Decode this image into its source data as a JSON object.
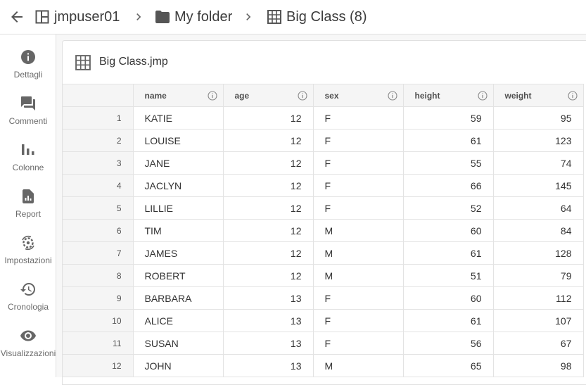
{
  "breadcrumb": {
    "user": "jmpuser01",
    "folder": "My folder",
    "table": "Big Class (8)"
  },
  "sidebar": {
    "items": [
      {
        "label": "Dettagli",
        "icon": "info-icon"
      },
      {
        "label": "Commenti",
        "icon": "comments-icon"
      },
      {
        "label": "Colonne",
        "icon": "columns-chart-icon"
      },
      {
        "label": "Report",
        "icon": "report-icon"
      },
      {
        "label": "Impostazioni",
        "icon": "settings-icon"
      },
      {
        "label": "Cronologia",
        "icon": "history-icon"
      },
      {
        "label": "Visualizzazioni",
        "icon": "eye-icon"
      }
    ]
  },
  "panel": {
    "title": "Big Class.jmp"
  },
  "table": {
    "columns": [
      "name",
      "age",
      "sex",
      "height",
      "weight"
    ],
    "rows": [
      {
        "n": "1",
        "name": "KATIE",
        "age": "12",
        "sex": "F",
        "height": "59",
        "weight": "95"
      },
      {
        "n": "2",
        "name": "LOUISE",
        "age": "12",
        "sex": "F",
        "height": "61",
        "weight": "123"
      },
      {
        "n": "3",
        "name": "JANE",
        "age": "12",
        "sex": "F",
        "height": "55",
        "weight": "74"
      },
      {
        "n": "4",
        "name": "JACLYN",
        "age": "12",
        "sex": "F",
        "height": "66",
        "weight": "145"
      },
      {
        "n": "5",
        "name": "LILLIE",
        "age": "12",
        "sex": "F",
        "height": "52",
        "weight": "64"
      },
      {
        "n": "6",
        "name": "TIM",
        "age": "12",
        "sex": "M",
        "height": "60",
        "weight": "84"
      },
      {
        "n": "7",
        "name": "JAMES",
        "age": "12",
        "sex": "M",
        "height": "61",
        "weight": "128"
      },
      {
        "n": "8",
        "name": "ROBERT",
        "age": "12",
        "sex": "M",
        "height": "51",
        "weight": "79"
      },
      {
        "n": "9",
        "name": "BARBARA",
        "age": "13",
        "sex": "F",
        "height": "60",
        "weight": "112"
      },
      {
        "n": "10",
        "name": "ALICE",
        "age": "13",
        "sex": "F",
        "height": "61",
        "weight": "107"
      },
      {
        "n": "11",
        "name": "SUSAN",
        "age": "13",
        "sex": "F",
        "height": "56",
        "weight": "67"
      },
      {
        "n": "12",
        "name": "JOHN",
        "age": "13",
        "sex": "M",
        "height": "65",
        "weight": "98"
      }
    ]
  }
}
